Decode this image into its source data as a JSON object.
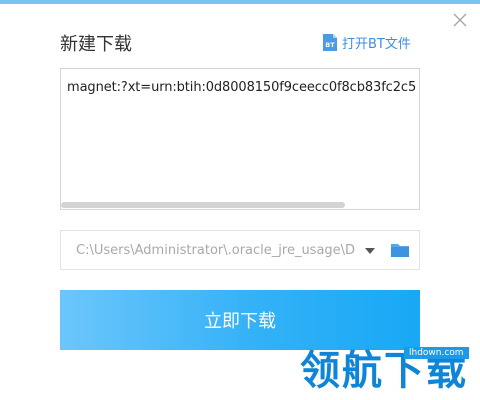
{
  "dialog": {
    "title": "新建下载",
    "open_bt_label": "打开BT文件",
    "close_icon": "close-icon",
    "accent_color": "#3f8ee0"
  },
  "url_input": {
    "value": "magnet:?xt=urn:btih:0d8008150f9ceecc0f8cb83fc2c5"
  },
  "save_path": {
    "value": "C:\\Users\\Administrator\\.oracle_jre_usage\\D",
    "dropdown_icon": "caret-down-icon",
    "folder_icon": "folder-icon"
  },
  "download_button": {
    "label": "立即下载",
    "gradient_start": "#6cc6fb",
    "gradient_end": "#18a8f5"
  },
  "watermark": {
    "text": "领航下载",
    "site": "lhdown.com"
  }
}
